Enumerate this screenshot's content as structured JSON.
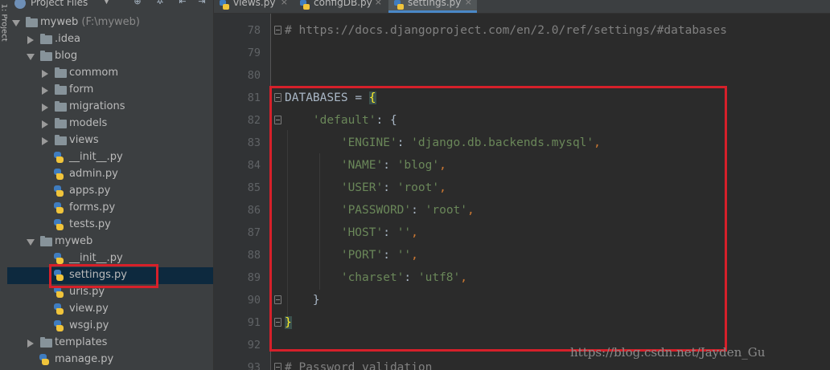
{
  "side_strip": {
    "label": "1: Project"
  },
  "project_panel": {
    "title": "Project Files",
    "tree": [
      {
        "label": "myweb",
        "sub": "(F:\\myweb)",
        "kind": "folder",
        "depth": 0,
        "expanded": true
      },
      {
        "label": ".idea",
        "kind": "folder",
        "depth": 1,
        "expanded": false
      },
      {
        "label": "blog",
        "kind": "folder",
        "depth": 1,
        "expanded": true
      },
      {
        "label": "commom",
        "kind": "folder",
        "depth": 2,
        "expanded": false
      },
      {
        "label": "form",
        "kind": "folder",
        "depth": 2,
        "expanded": false
      },
      {
        "label": "migrations",
        "kind": "folder",
        "depth": 2,
        "expanded": false
      },
      {
        "label": "models",
        "kind": "folder",
        "depth": 2,
        "expanded": false
      },
      {
        "label": "views",
        "kind": "folder",
        "depth": 2,
        "expanded": false
      },
      {
        "label": "__init__.py",
        "kind": "py",
        "depth": 2
      },
      {
        "label": "admin.py",
        "kind": "py",
        "depth": 2
      },
      {
        "label": "apps.py",
        "kind": "py",
        "depth": 2
      },
      {
        "label": "forms.py",
        "kind": "py",
        "depth": 2
      },
      {
        "label": "tests.py",
        "kind": "py",
        "depth": 2
      },
      {
        "label": "myweb",
        "kind": "folder",
        "depth": 1,
        "expanded": true
      },
      {
        "label": "__init__.py",
        "kind": "py",
        "depth": 2
      },
      {
        "label": "settings.py",
        "kind": "py",
        "depth": 2,
        "selected": true
      },
      {
        "label": "urls.py",
        "kind": "py",
        "depth": 2
      },
      {
        "label": "view.py",
        "kind": "py",
        "depth": 2
      },
      {
        "label": "wsgi.py",
        "kind": "py",
        "depth": 2
      },
      {
        "label": "templates",
        "kind": "folder",
        "depth": 1,
        "expanded": false
      },
      {
        "label": "manage.py",
        "kind": "py",
        "depth": 1
      }
    ]
  },
  "tabs": [
    {
      "label": "views.py",
      "active": false
    },
    {
      "label": "configDB.py",
      "active": false
    },
    {
      "label": "settings.py",
      "active": true
    }
  ],
  "editor": {
    "lines": [
      {
        "num": "78",
        "fold": true,
        "tokens": [
          {
            "t": "# https://docs.djangoproject.com/en/2.0/ref/settings/#databases",
            "c": "c-comment"
          }
        ]
      },
      {
        "num": "79",
        "tokens": []
      },
      {
        "num": "80",
        "tokens": []
      },
      {
        "num": "81",
        "fold": true,
        "tokens": [
          {
            "t": "DATABASES ",
            "c": "c-plain"
          },
          {
            "t": "=",
            "c": "c-plain"
          },
          {
            "t": " ",
            "c": "c-plain"
          },
          {
            "t": "{",
            "c": "c-brace-hl"
          }
        ]
      },
      {
        "num": "82",
        "fold": true,
        "tokens": [
          {
            "t": "    ",
            "c": "c-plain"
          },
          {
            "t": "'default'",
            "c": "c-str"
          },
          {
            "t": ": {",
            "c": "c-plain"
          }
        ]
      },
      {
        "num": "83",
        "tokens": [
          {
            "t": "        ",
            "c": "c-plain"
          },
          {
            "t": "'ENGINE'",
            "c": "c-str"
          },
          {
            "t": ": ",
            "c": "c-plain"
          },
          {
            "t": "'django.db.backends.mysql'",
            "c": "c-str"
          },
          {
            "t": ",",
            "c": "c-op"
          }
        ]
      },
      {
        "num": "84",
        "tokens": [
          {
            "t": "        ",
            "c": "c-plain"
          },
          {
            "t": "'NAME'",
            "c": "c-str"
          },
          {
            "t": ": ",
            "c": "c-plain"
          },
          {
            "t": "'blog'",
            "c": "c-str"
          },
          {
            "t": ",",
            "c": "c-op"
          }
        ]
      },
      {
        "num": "85",
        "tokens": [
          {
            "t": "        ",
            "c": "c-plain"
          },
          {
            "t": "'USER'",
            "c": "c-str"
          },
          {
            "t": ": ",
            "c": "c-plain"
          },
          {
            "t": "'root'",
            "c": "c-str"
          },
          {
            "t": ",",
            "c": "c-op"
          }
        ]
      },
      {
        "num": "86",
        "tokens": [
          {
            "t": "        ",
            "c": "c-plain"
          },
          {
            "t": "'PASSWORD'",
            "c": "c-str"
          },
          {
            "t": ": ",
            "c": "c-plain"
          },
          {
            "t": "'root'",
            "c": "c-str"
          },
          {
            "t": ",",
            "c": "c-op"
          }
        ]
      },
      {
        "num": "87",
        "tokens": [
          {
            "t": "        ",
            "c": "c-plain"
          },
          {
            "t": "'HOST'",
            "c": "c-str"
          },
          {
            "t": ": ",
            "c": "c-plain"
          },
          {
            "t": "''",
            "c": "c-str"
          },
          {
            "t": ",",
            "c": "c-op"
          }
        ]
      },
      {
        "num": "88",
        "tokens": [
          {
            "t": "        ",
            "c": "c-plain"
          },
          {
            "t": "'PORT'",
            "c": "c-str"
          },
          {
            "t": ": ",
            "c": "c-plain"
          },
          {
            "t": "''",
            "c": "c-str"
          },
          {
            "t": ",",
            "c": "c-op"
          }
        ]
      },
      {
        "num": "89",
        "tokens": [
          {
            "t": "        ",
            "c": "c-plain"
          },
          {
            "t": "'charset'",
            "c": "c-str"
          },
          {
            "t": ": ",
            "c": "c-plain"
          },
          {
            "t": "'utf8'",
            "c": "c-str"
          },
          {
            "t": ",",
            "c": "c-op"
          }
        ]
      },
      {
        "num": "90",
        "fold": true,
        "tokens": [
          {
            "t": "    }",
            "c": "c-plain"
          }
        ]
      },
      {
        "num": "91",
        "fold": true,
        "tokens": [
          {
            "t": "}",
            "c": "c-brace-hl"
          }
        ]
      },
      {
        "num": "92",
        "tokens": []
      },
      {
        "num": "93",
        "fold": true,
        "tokens": [
          {
            "t": "# Password validation",
            "c": "c-comment"
          }
        ]
      }
    ]
  },
  "watermark": "https://blog.csdn.net/Jayden_Gu",
  "colors": {
    "annotation_red": "#d6202a",
    "selection": "#0d293e",
    "string": "#6a8759",
    "comment": "#808080"
  }
}
